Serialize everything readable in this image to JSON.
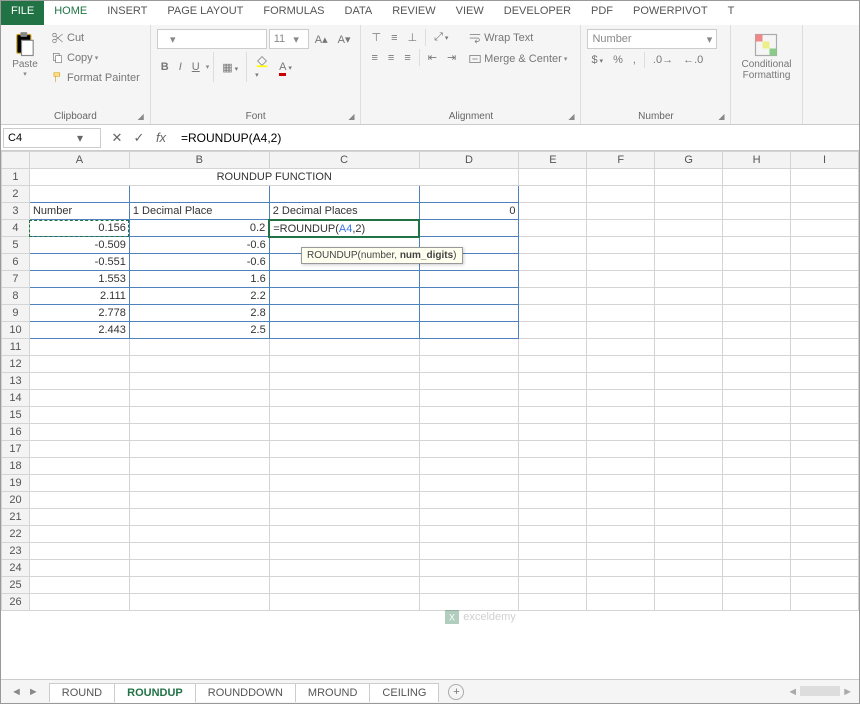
{
  "tabs": {
    "file": "FILE",
    "home": "HOME",
    "insert": "INSERT",
    "pagelayout": "PAGE LAYOUT",
    "formulas": "FORMULAS",
    "data": "DATA",
    "review": "REVIEW",
    "view": "VIEW",
    "developer": "DEVELOPER",
    "pdf": "PDF",
    "powerpivot": "POWERPIVOT",
    "t": "T"
  },
  "ribbon": {
    "clipboard": {
      "label": "Clipboard",
      "paste": "Paste",
      "cut": "Cut",
      "copy": "Copy",
      "painter": "Format Painter"
    },
    "font": {
      "label": "Font",
      "name": "",
      "size": "11",
      "bold": "B",
      "italic": "I",
      "underline": "U"
    },
    "alignment": {
      "label": "Alignment",
      "wrap": "Wrap Text",
      "merge": "Merge & Center"
    },
    "number": {
      "label": "Number",
      "format": "Number"
    },
    "styles": {
      "label": "",
      "cond": "Conditional",
      "cond2": "Formatting"
    }
  },
  "formula_bar": {
    "cell_ref": "C4",
    "formula": "=ROUNDUP(A4,2)"
  },
  "columns": [
    "A",
    "B",
    "C",
    "D",
    "E",
    "F",
    "G",
    "H",
    "I"
  ],
  "sheet": {
    "title": "ROUNDUP FUNCTION",
    "headers": {
      "a": "Number",
      "b": "1 Decimal Place",
      "c": "2 Decimal Places",
      "d": "0"
    },
    "rows": [
      {
        "a": "0.156",
        "b": "0.2"
      },
      {
        "a": "-0.509",
        "b": "-0.6"
      },
      {
        "a": "-0.551",
        "b": "-0.6"
      },
      {
        "a": "1.553",
        "b": "1.6"
      },
      {
        "a": "2.111",
        "b": "2.2"
      },
      {
        "a": "2.778",
        "b": "2.8"
      },
      {
        "a": "2.443",
        "b": "2.5"
      }
    ],
    "editing_formula_prefix": "=ROUNDUP(",
    "editing_formula_ref": "A4",
    "editing_formula_suffix": ",2)",
    "tooltip": "ROUNDUP(number, ",
    "tooltip_bold": "num_digits",
    "tooltip_end": ")"
  },
  "sheet_tabs": {
    "items": [
      "ROUND",
      "ROUNDUP",
      "ROUNDDOWN",
      "MROUND",
      "CEILING"
    ],
    "active_index": 1
  },
  "watermark": "exceldemy"
}
